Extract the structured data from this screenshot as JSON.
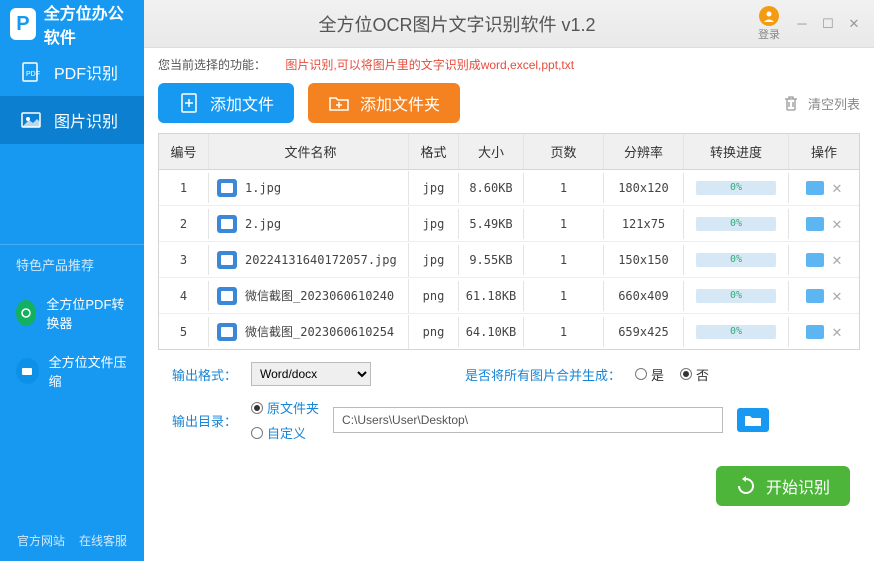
{
  "app": {
    "title": "全方位OCR图片文字识别软件 v1.2",
    "logo_text": "全方位办公软件",
    "login": "登录"
  },
  "nav": {
    "pdf": "PDF识别",
    "image": "图片识别"
  },
  "promo": {
    "header": "特色产品推荐",
    "pdf_converter": "全方位PDF转换器",
    "file_compress": "全方位文件压缩"
  },
  "footer": {
    "official": "官方网站",
    "service": "在线客服"
  },
  "func": {
    "label": "您当前选择的功能：",
    "desc": "图片识别,可以将图片里的文字识别成word,excel,ppt,txt"
  },
  "toolbar": {
    "add_file": "添加文件",
    "add_folder": "添加文件夹",
    "clear_list": "清空列表",
    "start": "开始识别"
  },
  "table": {
    "headers": {
      "idx": "编号",
      "name": "文件名称",
      "fmt": "格式",
      "size": "大小",
      "pages": "页数",
      "res": "分辨率",
      "prog": "转换进度",
      "op": "操作"
    },
    "rows": [
      {
        "idx": "1",
        "name": "1.jpg",
        "fmt": "jpg",
        "size": "8.60KB",
        "pages": "1",
        "res": "180x120",
        "prog": "0%"
      },
      {
        "idx": "2",
        "name": "2.jpg",
        "fmt": "jpg",
        "size": "5.49KB",
        "pages": "1",
        "res": "121x75",
        "prog": "0%"
      },
      {
        "idx": "3",
        "name": "20224131640172057.jpg",
        "fmt": "jpg",
        "size": "9.55KB",
        "pages": "1",
        "res": "150x150",
        "prog": "0%"
      },
      {
        "idx": "4",
        "name": "微信截图_2023060610240",
        "fmt": "png",
        "size": "61.18KB",
        "pages": "1",
        "res": "660x409",
        "prog": "0%"
      },
      {
        "idx": "5",
        "name": "微信截图_2023060610254",
        "fmt": "png",
        "size": "64.10KB",
        "pages": "1",
        "res": "659x425",
        "prog": "0%"
      }
    ]
  },
  "settings": {
    "output_format_label": "输出格式：",
    "output_format_value": "Word/docx",
    "merge_label": "是否将所有图片合并生成：",
    "merge_yes": "是",
    "merge_no": "否",
    "output_dir_label": "输出目录：",
    "dir_original": "原文件夹",
    "dir_custom": "自定义",
    "path": "C:\\Users\\User\\Desktop\\"
  }
}
